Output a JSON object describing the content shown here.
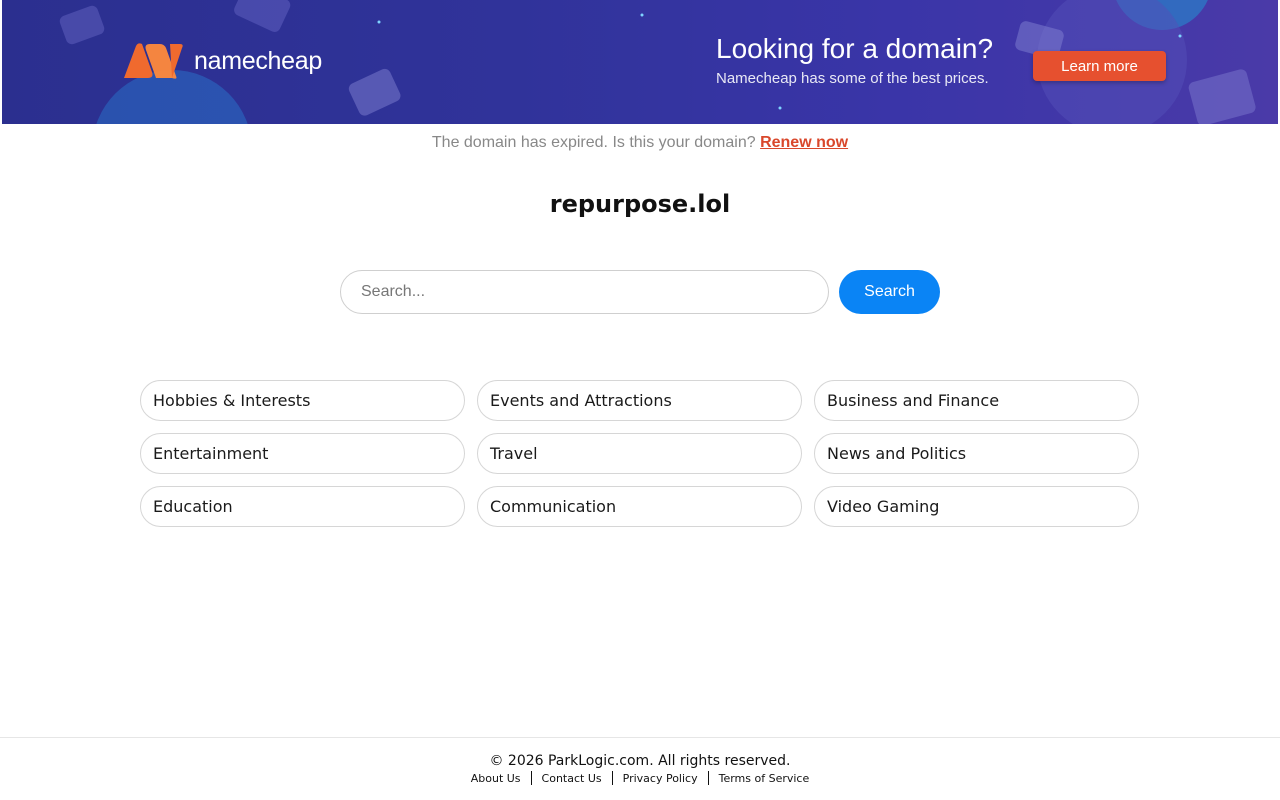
{
  "banner": {
    "brand": "namecheap",
    "promo_title": "Looking for a domain?",
    "promo_subtitle": "Namecheap has some of the best prices.",
    "learn_more_label": "Learn more",
    "colors": {
      "background": "#30339a",
      "logo_orange": "#f06a2e",
      "button": "#e6502f"
    }
  },
  "notice": {
    "text": "The domain has expired. Is this your domain?",
    "renew_label": "Renew now"
  },
  "domain": "repurpose.lol",
  "search": {
    "placeholder": "Search...",
    "button_label": "Search"
  },
  "categories": [
    "Hobbies & Interests",
    "Events and Attractions",
    "Business and Finance",
    "Entertainment",
    "Travel",
    "News and Politics",
    "Education",
    "Communication",
    "Video Gaming"
  ],
  "footer": {
    "copyright": "© 2026 ParkLogic.com. All rights reserved.",
    "links": [
      "About Us",
      "Contact Us",
      "Privacy Policy",
      "Terms of Service"
    ]
  }
}
